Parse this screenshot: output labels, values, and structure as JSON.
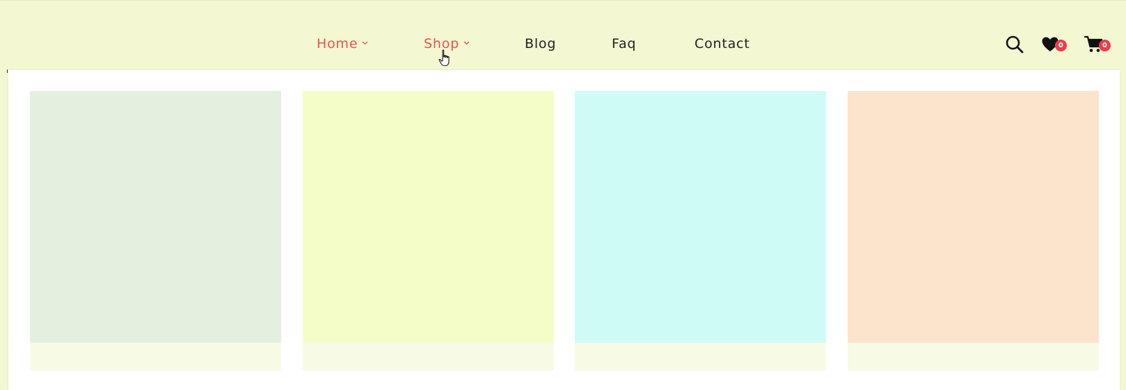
{
  "nav": {
    "items": [
      {
        "label": "Home",
        "has_dropdown": true,
        "active": true
      },
      {
        "label": "Shop",
        "has_dropdown": true,
        "active": true
      },
      {
        "label": "Blog",
        "has_dropdown": false,
        "active": false
      },
      {
        "label": "Faq",
        "has_dropdown": false,
        "active": false
      },
      {
        "label": "Contact",
        "has_dropdown": false,
        "active": false
      }
    ]
  },
  "header_icons": {
    "search": {
      "icon": "search-icon"
    },
    "wishlist": {
      "icon": "heart-icon",
      "count": "0"
    },
    "cart": {
      "icon": "cart-icon",
      "count": "0"
    }
  },
  "shop_menu": {
    "cards": [
      {
        "image_color": "#e4f0df",
        "caption": ""
      },
      {
        "image_color": "#f4fdc8",
        "caption": ""
      },
      {
        "image_color": "#cffbf7",
        "caption": ""
      },
      {
        "image_color": "#fce3cb",
        "caption": ""
      }
    ]
  },
  "colors": {
    "accent": "#e9524f",
    "background": "#f3f7d2",
    "badge": "#ee3d4a"
  }
}
